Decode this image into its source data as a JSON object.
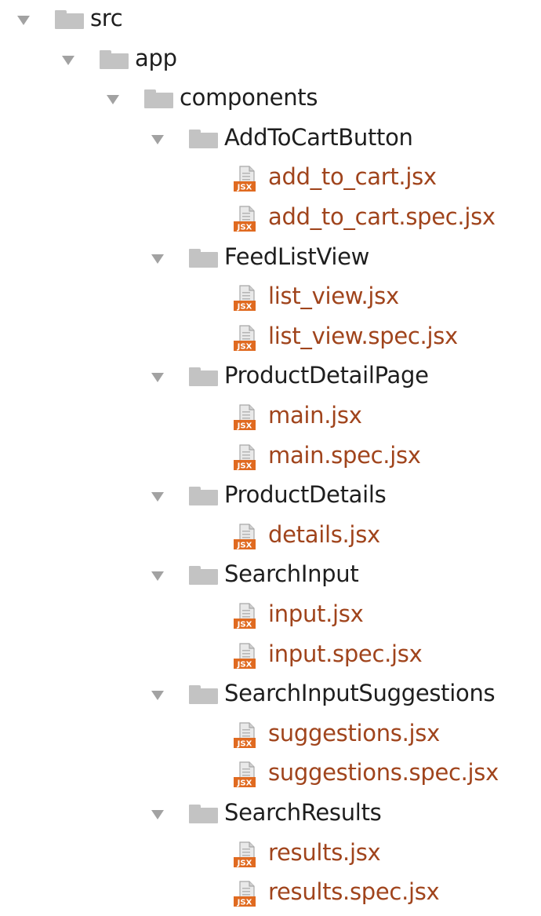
{
  "tree": [
    {
      "id": "src",
      "label": "src",
      "type": "folder",
      "depth": 0
    },
    {
      "id": "app",
      "label": "app",
      "type": "folder",
      "depth": 1
    },
    {
      "id": "components",
      "label": "components",
      "type": "folder",
      "depth": 2
    },
    {
      "id": "AddToCartButton",
      "label": "AddToCartButton",
      "type": "folder",
      "depth": 3
    },
    {
      "id": "add_to_cart.jsx",
      "label": "add_to_cart.jsx",
      "type": "file",
      "depth": 4,
      "icon": "jsx-file-icon",
      "badge": "JSX"
    },
    {
      "id": "add_to_cart.spec.jsx",
      "label": "add_to_cart.spec.jsx",
      "type": "file",
      "depth": 4,
      "icon": "jsx-file-icon",
      "badge": "JSX"
    },
    {
      "id": "FeedListView",
      "label": "FeedListView",
      "type": "folder",
      "depth": 3
    },
    {
      "id": "list_view.jsx",
      "label": "list_view.jsx",
      "type": "file",
      "depth": 4,
      "icon": "jsx-file-icon",
      "badge": "JSX"
    },
    {
      "id": "list_view.spec.jsx",
      "label": "list_view.spec.jsx",
      "type": "file",
      "depth": 4,
      "icon": "jsx-file-icon",
      "badge": "JSX"
    },
    {
      "id": "ProductDetailPage",
      "label": "ProductDetailPage",
      "type": "folder",
      "depth": 3
    },
    {
      "id": "main.jsx",
      "label": "main.jsx",
      "type": "file",
      "depth": 4,
      "icon": "jsx-file-icon",
      "badge": "JSX"
    },
    {
      "id": "main.spec.jsx",
      "label": "main.spec.jsx",
      "type": "file",
      "depth": 4,
      "icon": "jsx-file-icon",
      "badge": "JSX"
    },
    {
      "id": "ProductDetails",
      "label": "ProductDetails",
      "type": "folder",
      "depth": 3
    },
    {
      "id": "details.jsx",
      "label": "details.jsx",
      "type": "file",
      "depth": 4,
      "icon": "jsx-file-icon",
      "badge": "JSX"
    },
    {
      "id": "SearchInput",
      "label": "SearchInput",
      "type": "folder",
      "depth": 3
    },
    {
      "id": "input.jsx",
      "label": "input.jsx",
      "type": "file",
      "depth": 4,
      "icon": "jsx-file-icon",
      "badge": "JSX"
    },
    {
      "id": "input.spec.jsx",
      "label": "input.spec.jsx",
      "type": "file",
      "depth": 4,
      "icon": "jsx-file-icon",
      "badge": "JSX"
    },
    {
      "id": "SearchInputSuggestions",
      "label": "SearchInputSuggestions",
      "type": "folder",
      "depth": 3
    },
    {
      "id": "suggestions.jsx",
      "label": "suggestions.jsx",
      "type": "file",
      "depth": 4,
      "icon": "jsx-file-icon",
      "badge": "JSX"
    },
    {
      "id": "suggestions.spec.jsx",
      "label": "suggestions.spec.jsx",
      "type": "file",
      "depth": 4,
      "icon": "jsx-file-icon",
      "badge": "JSX"
    },
    {
      "id": "SearchResults",
      "label": "SearchResults",
      "type": "folder",
      "depth": 3
    },
    {
      "id": "results.jsx",
      "label": "results.jsx",
      "type": "file",
      "depth": 4,
      "icon": "jsx-file-icon",
      "badge": "JSX"
    },
    {
      "id": "results.spec.jsx",
      "label": "results.spec.jsx",
      "type": "file",
      "depth": 4,
      "icon": "jsx-file-icon",
      "badge": "JSX"
    }
  ],
  "colors": {
    "folder_text": "#1e1e1e",
    "file_text": "#a0441c",
    "folder_icon": "#c3c3c3",
    "arrow": "#a2a2a2",
    "jsx_badge": "#e06a20"
  }
}
